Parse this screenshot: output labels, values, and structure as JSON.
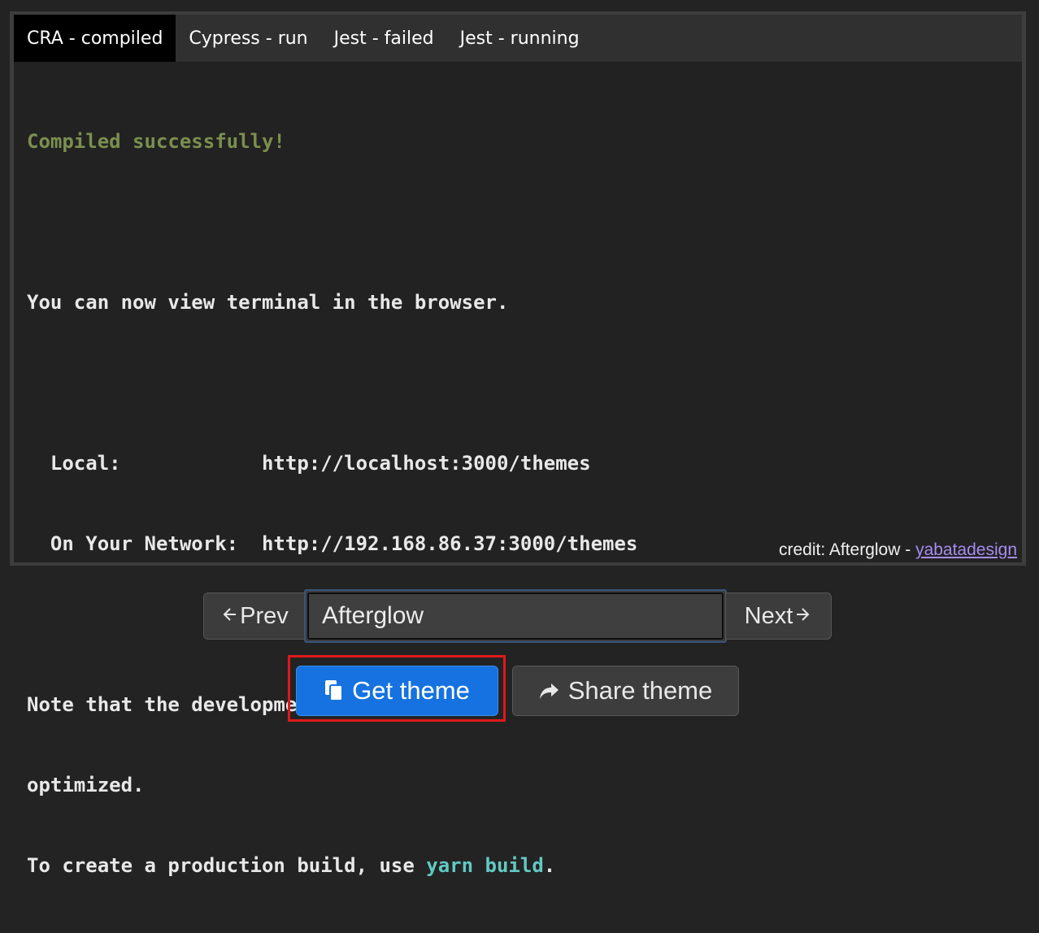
{
  "tabs": [
    {
      "label": "CRA - compiled",
      "active": true
    },
    {
      "label": "Cypress - run",
      "active": false
    },
    {
      "label": "Jest - failed",
      "active": false
    },
    {
      "label": "Jest - running",
      "active": false
    }
  ],
  "terminal": {
    "compiled": "Compiled successfully!",
    "view_line": "You can now view terminal in the browser.",
    "local_label": "  Local:            ",
    "local_url": "http://localhost:3000/themes",
    "network_label": "  On Your Network:  ",
    "network_url": "http://192.168.86.37:3000/themes",
    "note_line1": "Note that the development build is not",
    "note_line2": "optimized.",
    "prod_prefix": "To create a production build, use ",
    "prod_cmd": "yarn build",
    "prod_suffix": "."
  },
  "credit": {
    "prefix": "credit: Afterglow - ",
    "link": "yabatadesign"
  },
  "nav": {
    "prev_label": "Prev",
    "next_label": "Next",
    "theme_value": "Afterglow"
  },
  "actions": {
    "get_label": "Get theme",
    "share_label": "Share theme",
    "get_color": "#1572e0"
  },
  "colors": {
    "success": "#7b8f4e",
    "command": "#62c9c3",
    "link": "#a58cf0",
    "highlight": "#e01818"
  }
}
